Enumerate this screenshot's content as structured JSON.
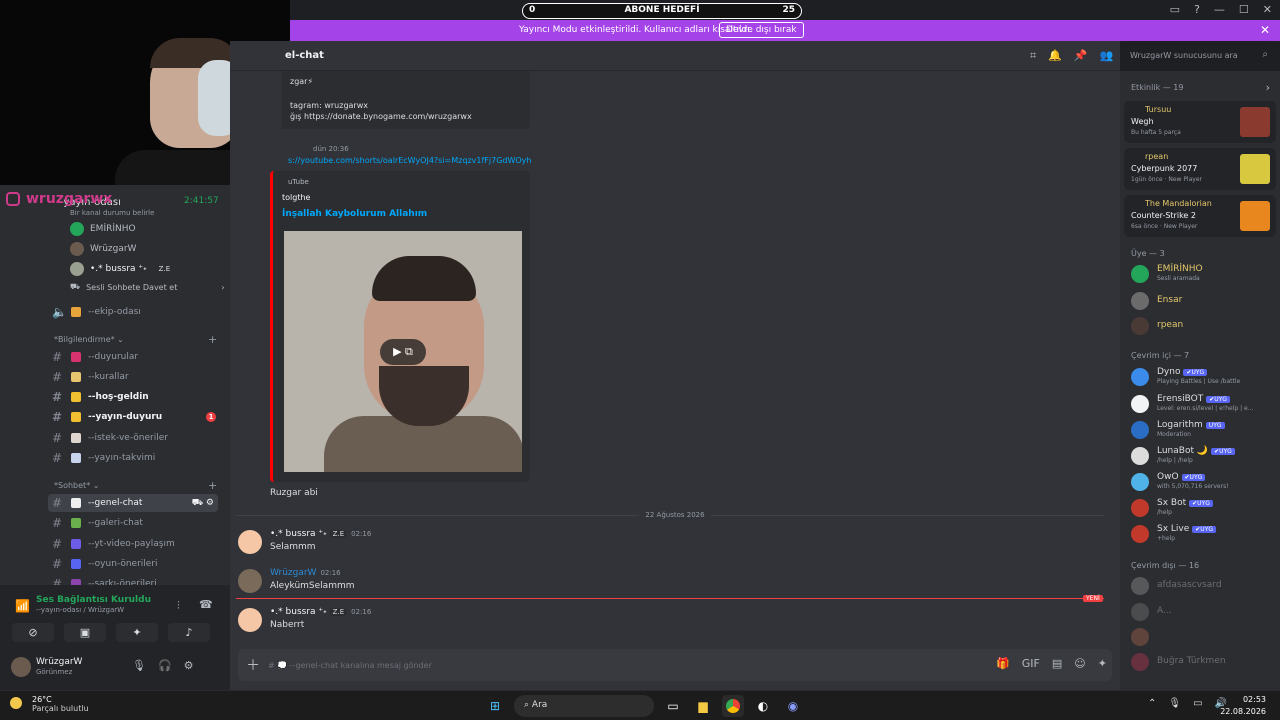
{
  "goal": {
    "left": "0",
    "center": "ABONE HEDEFİ",
    "right": "25"
  },
  "streamer": {
    "message": "Yayıncı Modu etkinleştirildi. Kullanıcı adları kısaltıldı.",
    "button": "Devre dışı bırak"
  },
  "instagram": {
    "handle": "wruzgarwx"
  },
  "voice_channel": {
    "name": "-yayın-odası",
    "timer": "2:41:57",
    "status_placeholder": "Bir kanal durumu belirle",
    "users": [
      "EMİRİNHO",
      "WrüzgarW",
      "•.* bussra ⁺˖",
      "Sesli Sohbete Davet et"
    ],
    "badge": "Z.E"
  },
  "channels": {
    "ekip": "--ekip-odası",
    "cat_info": "Bilgilendirme",
    "duyurular": "--duyurular",
    "kurallar": "--kurallar",
    "hosgeldin": "--hoş-geldin",
    "yayin_duyuru": "--yayın-duyuru",
    "yayin_badge": "1",
    "oneriler": "--istek-ve-öneriler",
    "takvim": "--yayın-takvimi",
    "cat_chat": "Sohbet",
    "genel": "--genel-chat",
    "galeri": "--galeri-chat",
    "yt": "--yt-video-paylaşım",
    "oyun": "--oyun-önerileri",
    "sarki": "--şarkı-önerileri"
  },
  "voice_panel": {
    "status": "Ses Bağlantısı Kuruldu",
    "sub": "--yayın-odası / WrüzgarW"
  },
  "user_panel": {
    "name": "WrüzgarW",
    "status": "Görünmez"
  },
  "chat": {
    "channel_title": "el-chat",
    "embed_lines": [
      "zgar⚡",
      "",
      "tagram: wruzgarwx",
      "ğış https://donate.bynogame.com/wruzgarwx"
    ],
    "time1": "dün 20:36",
    "link": "s://youtube.com/shorts/oalrEcWyOJ4?si=Mzqzv1fFj7GdWOyh",
    "yt_provider": "uTube",
    "yt_author": "tolgthe",
    "yt_title": "İnşallah Kaybolurum Allahım",
    "after_text": "Ruzgar abi",
    "date_divider": "22 Ağustos 2026",
    "new_label": "YENİ",
    "messages": [
      {
        "name": "•.* bussra ⁺˖",
        "badge": "Z.E",
        "time": "02:16",
        "text": "Selammm",
        "color": "#f5c7a6"
      },
      {
        "name": "WrüzgarW",
        "badge": "",
        "time": "02:16",
        "text": "AleykümSelammm",
        "color": "#2b8bd6"
      },
      {
        "name": "•.* bussra ⁺˖",
        "badge": "Z.E",
        "time": "02:16",
        "text": "Naberrt",
        "color": "#f5c7a6"
      }
    ],
    "composer_placeholder": "# 💭 --genel-chat kanalına mesaj gönder",
    "search_placeholder": "WruzgarW sunucusunu ara"
  },
  "members": {
    "activity_head": "Etkinlik — 19",
    "activities": [
      {
        "user": "Tursuu",
        "game": "Wegh",
        "sub": "Bu hafta 5 parça",
        "color": "#8b3a2f"
      },
      {
        "user": "rpean",
        "game": "Cyberpunk 2077",
        "sub": "1gün önce · New Player",
        "color": "#d8c840"
      },
      {
        "user": "The Mandalorian",
        "game": "Counter-Strike 2",
        "sub": "6sa önce · New Player",
        "color": "#e8871e"
      }
    ],
    "member_head": "Üye — 3",
    "members": [
      {
        "name": "EMİRİNHO",
        "desc": "Sesli aramada",
        "color": "#23a55a",
        "ncolor": "#e4c86b"
      },
      {
        "name": "Ensar",
        "desc": "",
        "color": "#6b6b6b",
        "ncolor": "#e4c86b"
      },
      {
        "name": "rpean",
        "desc": "",
        "color": "#4a3a35",
        "ncolor": "#e4c86b"
      }
    ],
    "online_head": "Çevrim içi — 7",
    "online": [
      {
        "name": "Dyno",
        "desc": "Playing Battles | Use /battle",
        "color": "#3b8beb"
      },
      {
        "name": "ErensiBOT",
        "desc": "Level: eren.si/level | e!help | e...",
        "color": "#f2f3f5"
      },
      {
        "name": "Logarithm",
        "desc": "Moderation",
        "color": "#3b8beb"
      },
      {
        "name": "LunaBot 🌙",
        "desc": "/help | /help",
        "color": "#dcdcdc"
      },
      {
        "name": "OwO",
        "desc": "with 5,070,716 servers!",
        "color": "#4fb3e8"
      },
      {
        "name": "Sx Bot",
        "desc": "/help",
        "color": "#c0392b"
      },
      {
        "name": "Sx Live",
        "desc": "+help",
        "color": "#c0392b"
      }
    ],
    "bot_tag": "✔UYG",
    "offline_head": "Çevrim dışı — 16",
    "offline": [
      "afdasascvsard",
      "A...",
      "",
      "Buğra Türkmen",
      ""
    ]
  },
  "taskbar": {
    "temp": "26°C",
    "weather": "Parçalı bulutlu",
    "search": "Ara",
    "time": "02:53",
    "date": "22.08.2026"
  }
}
